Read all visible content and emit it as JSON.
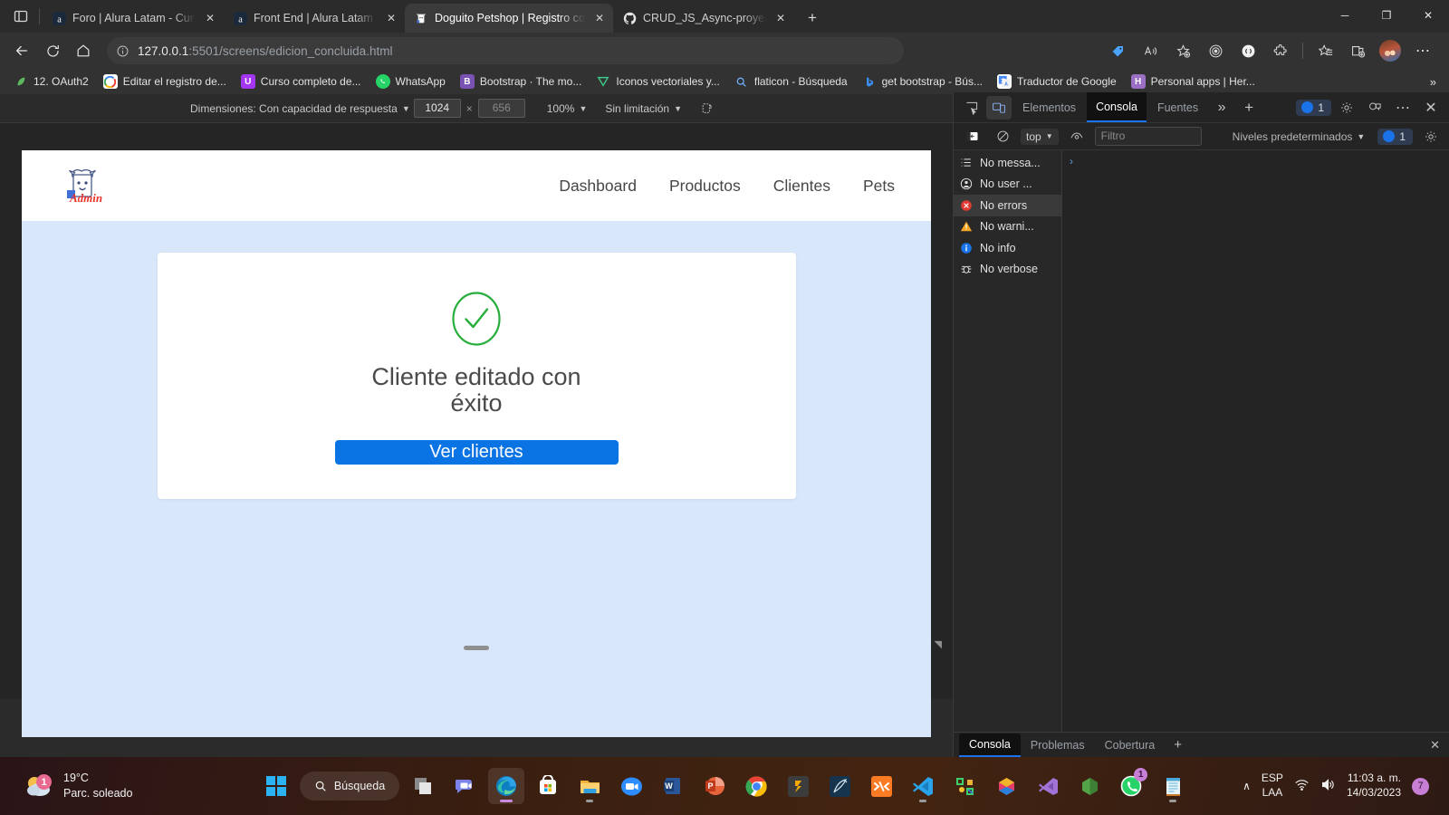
{
  "browser": {
    "tabs": [
      {
        "title": "Foro | Alura Latam - Cursos onlin",
        "favicon": "alura-icon",
        "active": false
      },
      {
        "title": "Front End | Alura Latam - Cursos",
        "favicon": "alura-icon",
        "active": false
      },
      {
        "title": "Doguito Petshop | Registro concl",
        "favicon": "doguito-icon",
        "active": true
      },
      {
        "title": "CRUD_JS_Async-proyecto_base/F",
        "favicon": "github-icon",
        "active": false
      }
    ],
    "new_tab_label": "+",
    "window_controls": {
      "minimize": "─",
      "maximize": "❐",
      "close": "✕"
    },
    "address": {
      "prefix": "127.0.0.1",
      "suffix": ":5501/screens/edicion_concluida.html"
    },
    "nav_icons": [
      "back-icon",
      "reload-icon",
      "home-icon",
      "info-icon"
    ],
    "toolbar_right_icons": [
      "price-tag-icon",
      "read-aloud-icon",
      "add-favorite-icon",
      "collections-target-icon",
      "browser-essentials-icon",
      "extensions-icon",
      "favorites-icon",
      "split-screen-icon",
      "profile-avatar",
      "settings-more-icon"
    ],
    "bookmarks": [
      {
        "label": "12. OAuth2",
        "icon": "leaf-icon",
        "color": "#3cb371"
      },
      {
        "label": "Editar el registro de...",
        "icon": "google-icon",
        "color": "#ffffff"
      },
      {
        "label": "Curso completo de...",
        "icon": "udemy-icon",
        "color": "#a435f0"
      },
      {
        "label": "WhatsApp",
        "icon": "whatsapp-icon",
        "color": "#25d366"
      },
      {
        "label": "Bootstrap · The mo...",
        "icon": "bootstrap-icon",
        "color": "#7952b3"
      },
      {
        "label": "Iconos vectoriales y...",
        "icon": "flaticon-icon",
        "color": "#3cb371"
      },
      {
        "label": "flaticon - Búsqueda",
        "icon": "search-icon",
        "color": "#4a90e2"
      },
      {
        "label": "get bootstrap - Bús...",
        "icon": "bing-icon",
        "color": "#2b7de9"
      },
      {
        "label": "Traductor de Google",
        "icon": "google-translate-icon",
        "color": "#4285f4"
      },
      {
        "label": "Personal apps | Her...",
        "icon": "heroku-icon",
        "color": "#9b6fc4"
      }
    ],
    "bookmarks_overflow": "»"
  },
  "device_toolbar": {
    "dimensions_label": "Dimensiones: Con capacidad de respuesta",
    "width_value": "1024",
    "height_value": "656",
    "height_placeholder": "656",
    "times": "×",
    "zoom_value": "100%",
    "throttling_value": "Sin limitación",
    "rotate_icon": "rotate-device-icon",
    "more_options": "⋯"
  },
  "page": {
    "logo_alt": "doguito-admin-logo",
    "logo_word": "Admin",
    "nav": [
      {
        "label": "Dashboard"
      },
      {
        "label": "Productos"
      },
      {
        "label": "Clientes"
      },
      {
        "label": "Pets"
      }
    ],
    "card": {
      "icon": "success-check-icon",
      "title": "Cliente editado con éxito",
      "button_label": "Ver clientes",
      "button_color": "#0b74e5",
      "check_color": "#27ae3c"
    },
    "background_color": "#d9e7fb"
  },
  "devtools": {
    "toolbar": {
      "inspect_icon": "inspect-element-icon",
      "device_toggle_icon": "device-toolbar-icon",
      "tabs": [
        {
          "label": "Elementos",
          "active": false
        },
        {
          "label": "Consola",
          "active": true
        },
        {
          "label": "Fuentes",
          "active": false
        }
      ],
      "more_tabs": "»",
      "add_tab": "+",
      "issues_count": "1",
      "settings_icon": "gear-icon",
      "feedback_icon": "feedback-icon",
      "more_icon": "⋯",
      "close_icon": "✕"
    },
    "filterbar": {
      "sidebar_toggle_icon": "console-sidebar-icon",
      "clear_icon": "clear-console-icon",
      "context": "top",
      "eye_icon": "live-expression-icon",
      "filter_placeholder": "Filtro",
      "filter_value": "",
      "levels_label": "Niveles predeterminados",
      "issues_count": "1",
      "settings_icon": "gear-icon"
    },
    "sidebar": [
      {
        "label": "No messa...",
        "icon": "list-icon",
        "selected": false
      },
      {
        "label": "No user ...",
        "icon": "user-icon",
        "selected": false
      },
      {
        "label": "No errors",
        "icon": "error-icon",
        "selected": true
      },
      {
        "label": "No warni...",
        "icon": "warning-icon",
        "selected": false
      },
      {
        "label": "No info",
        "icon": "info-icon",
        "selected": false
      },
      {
        "label": "No verbose",
        "icon": "bug-icon",
        "selected": false
      }
    ],
    "console_prompt": "›",
    "drawer_tabs": [
      {
        "label": "Consola",
        "active": true
      },
      {
        "label": "Problemas",
        "active": false
      },
      {
        "label": "Cobertura",
        "active": false
      }
    ],
    "drawer_add": "+",
    "drawer_close": "✕"
  },
  "taskbar": {
    "weather": {
      "temp": "19°C",
      "condition": "Parc. soleado",
      "badge": "1"
    },
    "search_label": "Búsqueda",
    "apps": [
      {
        "name": "start-button"
      },
      {
        "name": "search-pill"
      },
      {
        "name": "task-view"
      },
      {
        "name": "teams-icon"
      },
      {
        "name": "edge-icon"
      },
      {
        "name": "microsoft-store-icon"
      },
      {
        "name": "file-explorer-icon"
      },
      {
        "name": "zoom-icon"
      },
      {
        "name": "word-icon"
      },
      {
        "name": "powerpoint-icon"
      },
      {
        "name": "chrome-icon"
      },
      {
        "name": "sublime-text-icon"
      },
      {
        "name": "pen-tool-icon"
      },
      {
        "name": "xampp-icon"
      },
      {
        "name": "vscode-icon"
      },
      {
        "name": "figma-icon"
      },
      {
        "name": "photoshop-icon"
      },
      {
        "name": "visual-studio-icon"
      },
      {
        "name": "node-icon"
      },
      {
        "name": "whatsapp-icon",
        "badge": "1"
      },
      {
        "name": "notepad-icon"
      }
    ],
    "tray": {
      "chevron": "∧",
      "lang_line1": "ESP",
      "lang_line2": "LAA",
      "wifi_icon": "wifi-icon",
      "volume_icon": "volume-icon",
      "time": "11:03 a. m.",
      "date": "14/03/2023",
      "notification_count": "7"
    }
  }
}
